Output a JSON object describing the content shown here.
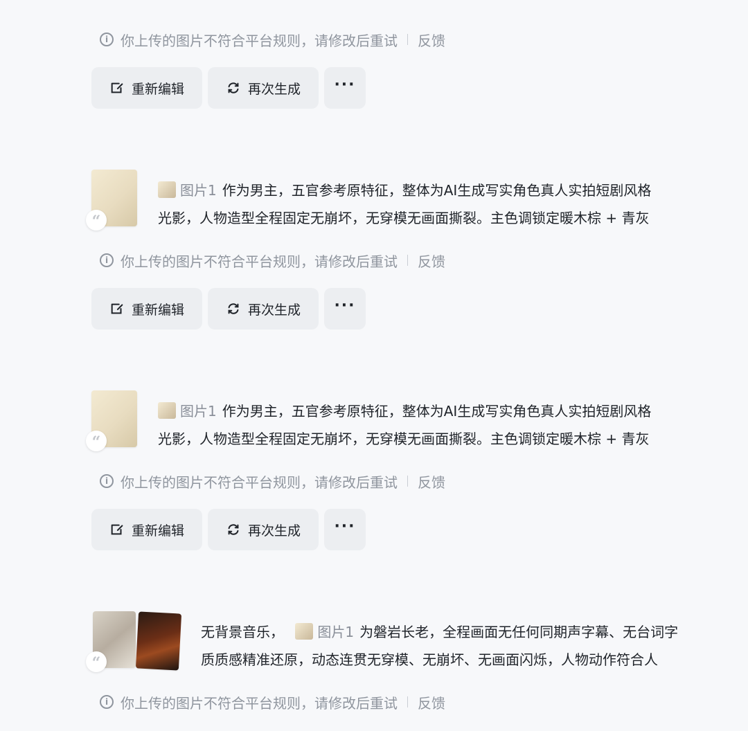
{
  "prompt_prefix_ref": "图片1",
  "prompt_a_line1": "作为男主，五官参考原特征，整体为AI生成写实角色真人实拍短剧风格",
  "prompt_a_line2": "光影，人物造型全程固定无崩坏，无穿模无画面撕裂。主色调锁定暖木棕 + 青灰",
  "prompt_top_partial": "光影，人物造型全程固定无崩坏，无穿模无画面撕裂。主色调锁定暖木棕 + 青灰",
  "prompt_b_pre": "无背景音乐，",
  "prompt_b_line1": "为磐岩长老，全程画面无任何同期声字幕、无台词字",
  "prompt_b_line2": "质质感精准还原，动态连贯无穿模、无崩坏、无画面闪烁，人物动作符合人",
  "notice": {
    "text": "你上传的图片不符合平台规则，请修改后重试",
    "feedback": "反馈",
    "icon": "info-icon"
  },
  "actions": {
    "re_edit": "重新编辑",
    "regenerate": "再次生成",
    "more": "···"
  },
  "colors": {
    "background": "#f7f8fa",
    "button_bg": "#eceef1",
    "muted_text": "#8f959e"
  }
}
